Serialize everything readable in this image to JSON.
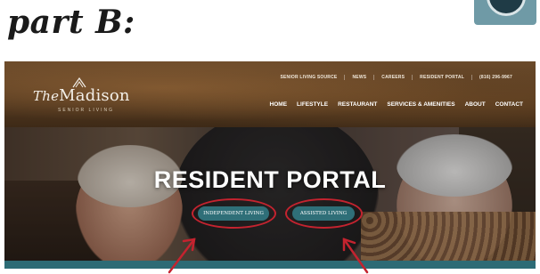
{
  "annotation": {
    "heading": "part B:"
  },
  "site": {
    "logo_name_prefix": "The",
    "logo_name": "Madison",
    "logo_subtitle": "SENIOR LIVING",
    "utility_nav": [
      "SENIOR LIVING SOURCE",
      "NEWS",
      "CAREERS",
      "RESIDENT PORTAL",
      "(816) 296-9967"
    ],
    "main_nav": [
      "HOME",
      "LIFESTYLE",
      "RESTAURANT",
      "SERVICES & AMENITIES",
      "ABOUT",
      "CONTACT"
    ]
  },
  "hero": {
    "title": "RESIDENT PORTAL",
    "buttons": [
      "INDEPENDENT LIVING",
      "ASSISTED LIVING"
    ]
  },
  "colors": {
    "header_brown": "#553a20",
    "button_teal": "#2f6f78",
    "annotation_red": "#c4232f",
    "bar_teal": "#2d6b75"
  },
  "icons": {
    "chat": "chat-bubble-icon",
    "logo_mark": "mountain-mark-icon"
  }
}
